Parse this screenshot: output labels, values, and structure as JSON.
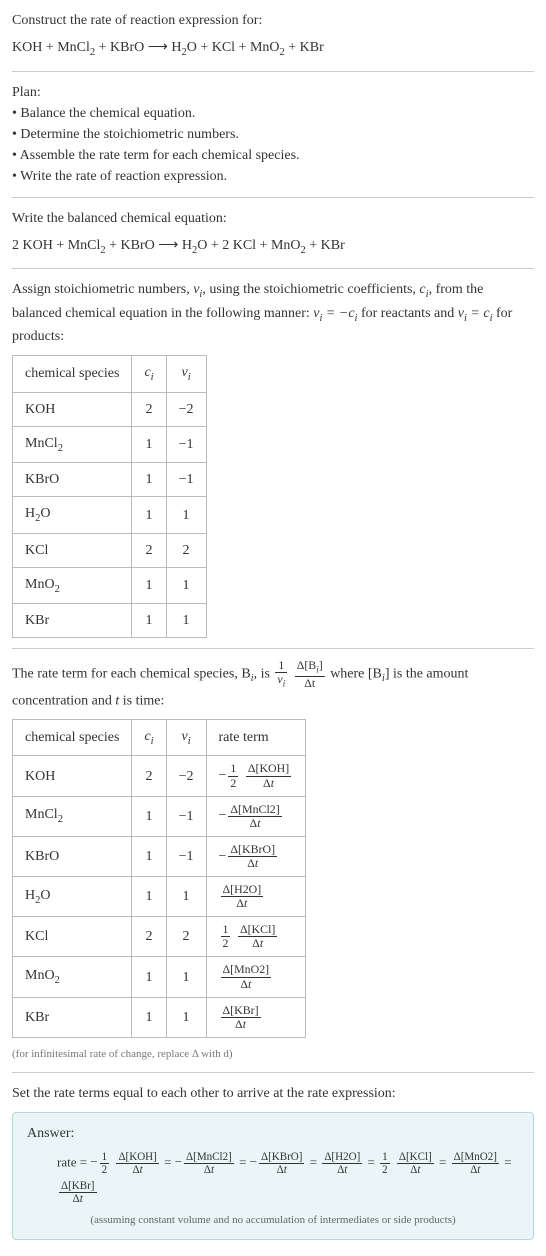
{
  "intro": {
    "prompt": "Construct the rate of reaction expression for:",
    "equation_lhs": "KOH + MnCl",
    "equation_mid1": " + KBrO ⟶ H",
    "equation_mid2": "O + KCl + MnO",
    "equation_end": " + KBr"
  },
  "plan": {
    "heading": "Plan:",
    "items": [
      "Balance the chemical equation.",
      "Determine the stoichiometric numbers.",
      "Assemble the rate term for each chemical species.",
      "Write the rate of reaction expression."
    ]
  },
  "balanced": {
    "heading": "Write the balanced chemical equation:",
    "eq_p1": "2 KOH + MnCl",
    "eq_p2": " + KBrO ⟶ H",
    "eq_p3": "O + 2 KCl + MnO",
    "eq_p4": " + KBr"
  },
  "stoich": {
    "text_p1": "Assign stoichiometric numbers, ",
    "text_p2": ", using the stoichiometric coefficients, ",
    "text_p3": ", from the balanced chemical equation in the following manner: ",
    "text_p4": " for reactants and ",
    "text_p5": " for products:",
    "nu_i": "ν",
    "c_i": "c",
    "rel1_lhs": "ν",
    "rel1_rhs": " = −c",
    "rel2_lhs": "ν",
    "rel2_rhs": " = c",
    "headers": [
      "chemical species",
      "c",
      "ν"
    ],
    "rows": [
      {
        "species": "KOH",
        "sub": "",
        "c": "2",
        "nu": "−2"
      },
      {
        "species": "MnCl",
        "sub": "2",
        "c": "1",
        "nu": "−1"
      },
      {
        "species": "KBrO",
        "sub": "",
        "c": "1",
        "nu": "−1"
      },
      {
        "species": "H",
        "sub": "2",
        "suffix": "O",
        "c": "1",
        "nu": "1"
      },
      {
        "species": "KCl",
        "sub": "",
        "c": "2",
        "nu": "2"
      },
      {
        "species": "MnO",
        "sub": "2",
        "c": "1",
        "nu": "1"
      },
      {
        "species": "KBr",
        "sub": "",
        "c": "1",
        "nu": "1"
      }
    ]
  },
  "rateterm": {
    "text_p1": "The rate term for each chemical species, B",
    "text_p2": ", is ",
    "text_p3": " where [B",
    "text_p4": "] is the amount concentration and ",
    "text_p5": " is time:",
    "t_var": "t",
    "frac1_num": "1",
    "frac1_den_sym": "ν",
    "frac2_num": "Δ[B",
    "frac2_num_end": "]",
    "frac2_den": "Δt",
    "headers": [
      "chemical species",
      "c",
      "ν",
      "rate term"
    ],
    "rows": [
      {
        "species": "KOH",
        "sub": "",
        "c": "2",
        "nu": "−2",
        "neg": true,
        "coef_num": "1",
        "coef_den": "2",
        "conc": "Δ[KOH]"
      },
      {
        "species": "MnCl",
        "sub": "2",
        "c": "1",
        "nu": "−1",
        "neg": true,
        "coef_num": "",
        "coef_den": "",
        "conc": "Δ[MnCl2]"
      },
      {
        "species": "KBrO",
        "sub": "",
        "c": "1",
        "nu": "−1",
        "neg": true,
        "coef_num": "",
        "coef_den": "",
        "conc": "Δ[KBrO]"
      },
      {
        "species": "H",
        "sub": "2",
        "suffix": "O",
        "c": "1",
        "nu": "1",
        "neg": false,
        "coef_num": "",
        "coef_den": "",
        "conc": "Δ[H2O]"
      },
      {
        "species": "KCl",
        "sub": "",
        "c": "2",
        "nu": "2",
        "neg": false,
        "coef_num": "1",
        "coef_den": "2",
        "conc": "Δ[KCl]"
      },
      {
        "species": "MnO",
        "sub": "2",
        "c": "1",
        "nu": "1",
        "neg": false,
        "coef_num": "",
        "coef_den": "",
        "conc": "Δ[MnO2]"
      },
      {
        "species": "KBr",
        "sub": "",
        "c": "1",
        "nu": "1",
        "neg": false,
        "coef_num": "",
        "coef_den": "",
        "conc": "Δ[KBr]"
      }
    ],
    "footnote": "(for infinitesimal rate of change, replace Δ with d)"
  },
  "final": {
    "heading": "Set the rate terms equal to each other to arrive at the rate expression:",
    "answer_label": "Answer:",
    "rate_word": "rate = ",
    "terms": [
      {
        "neg": true,
        "coef_num": "1",
        "coef_den": "2",
        "conc": "Δ[KOH]"
      },
      {
        "neg": true,
        "coef_num": "",
        "coef_den": "",
        "conc": "Δ[MnCl2]"
      },
      {
        "neg": true,
        "coef_num": "",
        "coef_den": "",
        "conc": "Δ[KBrO]"
      },
      {
        "neg": false,
        "coef_num": "",
        "coef_den": "",
        "conc": "Δ[H2O]"
      },
      {
        "neg": false,
        "coef_num": "1",
        "coef_den": "2",
        "conc": "Δ[KCl]"
      },
      {
        "neg": false,
        "coef_num": "",
        "coef_den": "",
        "conc": "Δ[MnO2]"
      },
      {
        "neg": false,
        "coef_num": "",
        "coef_den": "",
        "conc": "Δ[KBr]"
      }
    ],
    "dt": "Δt",
    "eq_sep": " = ",
    "subnote": "(assuming constant volume and no accumulation of intermediates or side products)"
  }
}
